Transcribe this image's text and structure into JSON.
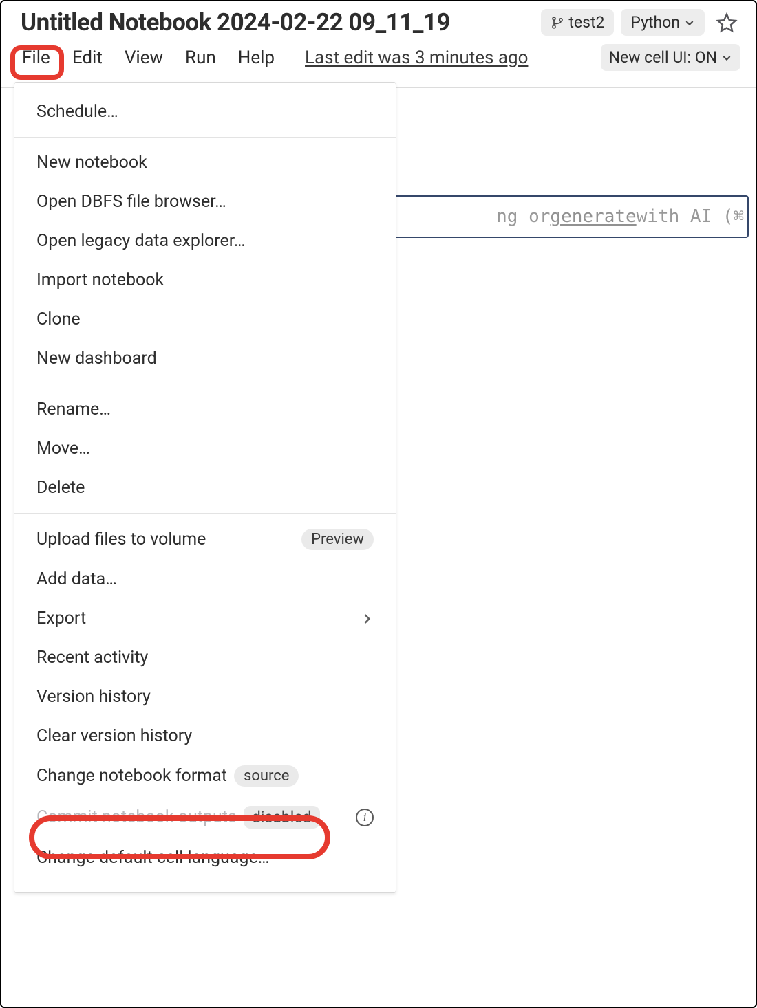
{
  "header": {
    "title": "Untitled Notebook 2024-02-22 09_11_19",
    "branch_label": "test2",
    "language_label": "Python",
    "menu": {
      "file": "File",
      "edit": "Edit",
      "view": "View",
      "run": "Run",
      "help": "Help"
    },
    "last_edit": "Last edit was 3 minutes ago",
    "new_cell_ui": "New cell UI: ON"
  },
  "editor": {
    "placeholder_mid": "ng or ",
    "placeholder_gen": "generate",
    "placeholder_tail": " with AI (⌘ + I)..."
  },
  "file_menu": {
    "schedule": "Schedule…",
    "new_notebook": "New notebook",
    "open_dbfs": "Open DBFS file browser…",
    "open_legacy": "Open legacy data explorer…",
    "import_notebook": "Import notebook",
    "clone": "Clone",
    "new_dashboard": "New dashboard",
    "rename": "Rename…",
    "move": "Move…",
    "delete": "Delete",
    "upload_volume": "Upload files to volume",
    "upload_badge": "Preview",
    "add_data": "Add data…",
    "export": "Export",
    "recent_activity": "Recent activity",
    "version_history": "Version history",
    "clear_version_history": "Clear version history",
    "change_format": "Change notebook format",
    "format_badge": "source",
    "commit_outputs": "Commit notebook outputs",
    "commit_badge": "disabled",
    "change_default_lang": "Change default cell language…"
  }
}
